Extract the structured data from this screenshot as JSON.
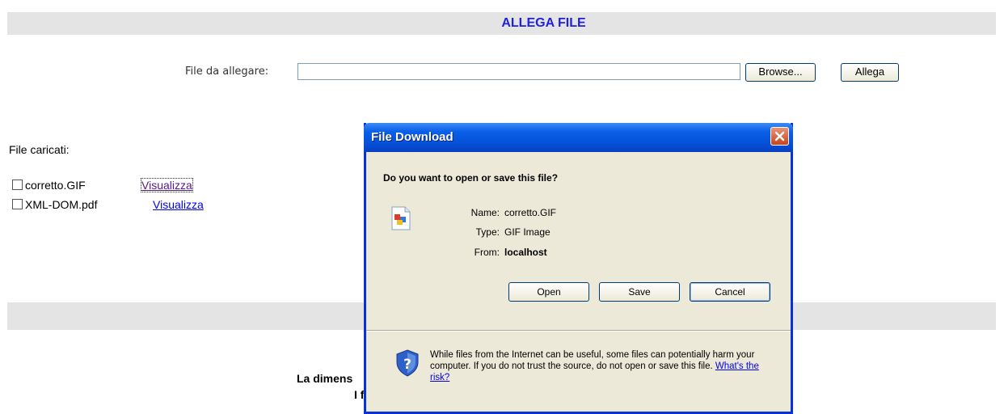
{
  "page": {
    "title": "ALLEGA FILE",
    "upload_label": "File da allegare:",
    "browse_label": "Browse...",
    "attach_label": "Allega",
    "loaded_title": "File caricati:",
    "files": [
      {
        "name": "corretto.GIF",
        "link": "Visualizza"
      },
      {
        "name": "XML-DOM.pdf",
        "link": "Visualizza"
      }
    ],
    "bottom_text_1": "La dimens",
    "bottom_text_2": "I f"
  },
  "dialog": {
    "title": "File Download",
    "question": "Do you want to open or save this file?",
    "name_label": "Name:",
    "name_value": "corretto.GIF",
    "type_label": "Type:",
    "type_value": "GIF Image",
    "from_label": "From:",
    "from_value": "localhost",
    "open_label": "Open",
    "save_label": "Save",
    "cancel_label": "Cancel",
    "warning_text": "While files from the Internet can be useful, some files can potentially harm your computer. If you do not trust the source, do not open or save this file.",
    "risk_link": "What's the risk?"
  },
  "colors": {
    "title_text": "#1f1fe0",
    "dialog_titlebar": "#0a5fe8",
    "link": "#0000ee",
    "visited_link": "#551a8b"
  }
}
